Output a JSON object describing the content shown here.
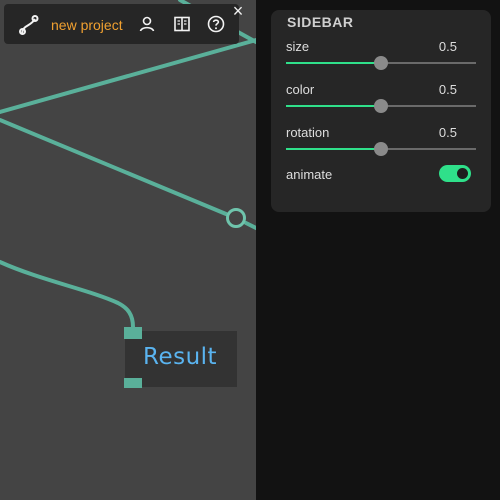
{
  "toolbar": {
    "project_name": "new project",
    "logo_icon": "curve-logo-icon",
    "user_icon": "user-icon",
    "docs_icon": "book-icon",
    "help_icon": "help-icon",
    "close_label": "×"
  },
  "node": {
    "label": "Result"
  },
  "sidebar": {
    "title": "SIDEBAR",
    "controls": [
      {
        "label": "size",
        "value": "0.5",
        "fraction": 0.5
      },
      {
        "label": "color",
        "value": "0.5",
        "fraction": 0.5
      },
      {
        "label": "rotation",
        "value": "0.5",
        "fraction": 0.5
      }
    ],
    "animate": {
      "label": "animate",
      "checked": true
    }
  },
  "colors": {
    "accent": "#2fe08a",
    "wire": "#5ab09a",
    "project_name": "#f0a030",
    "node_label": "#5ab4f0"
  }
}
